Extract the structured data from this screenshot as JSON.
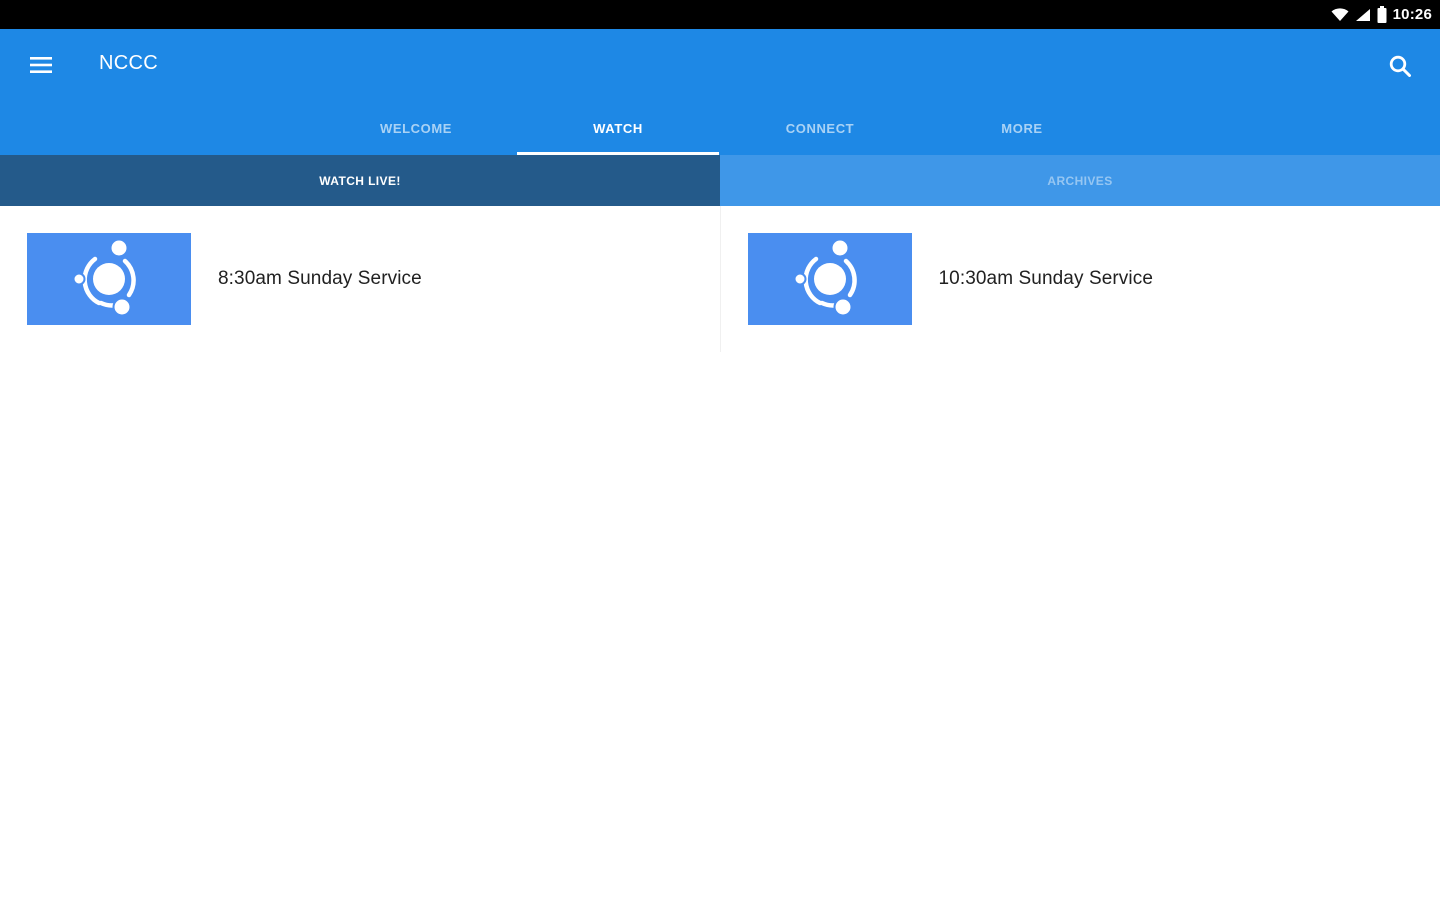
{
  "status_bar": {
    "time": "10:26",
    "icons": [
      "wifi-icon",
      "signal-icon",
      "battery-icon"
    ]
  },
  "app_bar": {
    "title": "NCCC",
    "menu_icon": "menu-icon",
    "search_icon": "search-icon",
    "color": "#1e88e5"
  },
  "tabs": [
    {
      "label": "WELCOME",
      "active": false
    },
    {
      "label": "WATCH",
      "active": true
    },
    {
      "label": "CONNECT",
      "active": false
    },
    {
      "label": "MORE",
      "active": false
    }
  ],
  "sub_tabs": [
    {
      "label": "WATCH LIVE!",
      "active": true
    },
    {
      "label": "ARCHIVES",
      "active": false
    }
  ],
  "services": [
    {
      "title": "8:30am Sunday Service",
      "thumb_icon": "app-logo-icon"
    },
    {
      "title": "10:30am Sunday Service",
      "thumb_icon": "app-logo-icon"
    }
  ],
  "colors": {
    "accent": "#1e88e5",
    "sub_tab_active": "#245a8a",
    "sub_tab_inactive": "#3f97e8",
    "thumb": "#4a8ef0"
  }
}
